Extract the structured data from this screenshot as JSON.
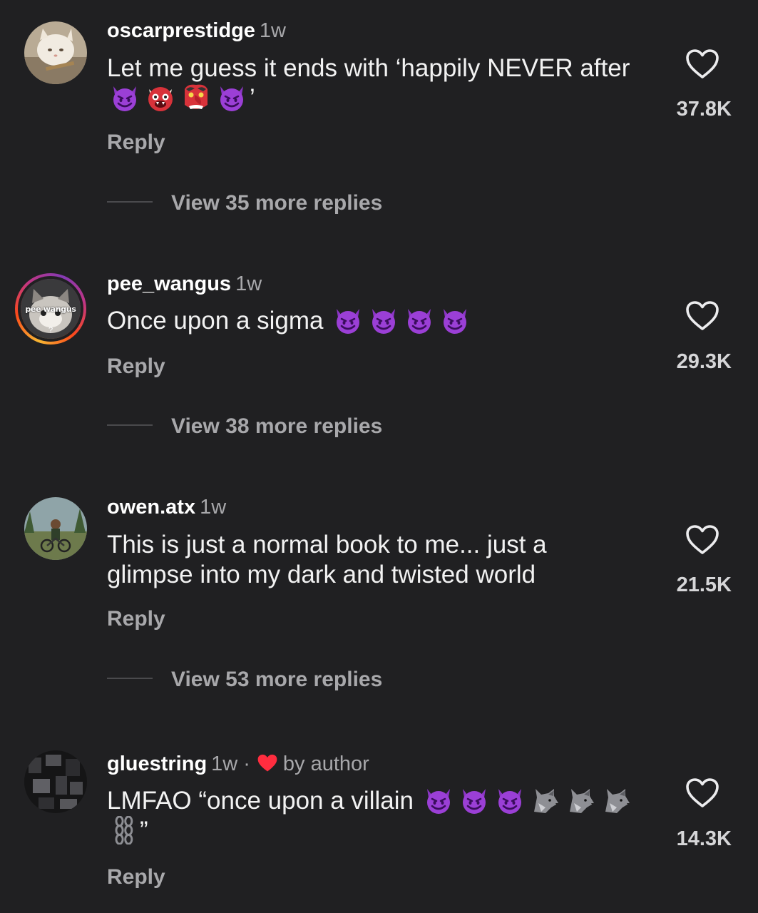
{
  "comments": [
    {
      "username": "oscarprestidge",
      "time": "1w",
      "text_parts": [
        "Let me guess it ends with ‘happily NEVER after",
        "’"
      ],
      "emojis": [
        "smiling-devil",
        "ogre",
        "goblin",
        "smiling-devil"
      ],
      "reply_label": "Reply",
      "view_more": "View 35 more replies",
      "likes": "37.8K",
      "avatar_icon": "cat-avatar"
    },
    {
      "username": "pee_wangus",
      "time": "1w",
      "text": "Once upon a sigma",
      "emojis": [
        "smiling-devil",
        "smiling-devil",
        "smiling-devil",
        "smiling-devil"
      ],
      "reply_label": "Reply",
      "view_more": "View 38 more replies",
      "likes": "29.3K",
      "avatar_text": "pee wangus",
      "avatar_mark": "?",
      "avatar_icon": "cat-story-avatar"
    },
    {
      "username": "owen.atx",
      "time": "1w",
      "text": "This is just a normal book to me... just a glimpse into my dark and twisted world",
      "reply_label": "Reply",
      "view_more": "View 53 more replies",
      "likes": "21.5K",
      "avatar_icon": "bike-rider-avatar"
    },
    {
      "username": "gluestring",
      "time": "1w",
      "separator": "·",
      "liked_by": "by author",
      "text_parts": [
        "LMFAO “once upon a villain",
        "”"
      ],
      "emojis": [
        "smiling-devil",
        "smiling-devil",
        "smiling-devil",
        "wolf",
        "wolf",
        "wolf",
        "chains"
      ],
      "reply_label": "Reply",
      "likes": "14.3K",
      "avatar_icon": "dark-collage-avatar"
    }
  ],
  "colors": {
    "background": "#202022",
    "secondary_text": "#a8a8ab",
    "devil_purple": "#9b3fd6",
    "liked_heart": "#ff2d3f"
  }
}
